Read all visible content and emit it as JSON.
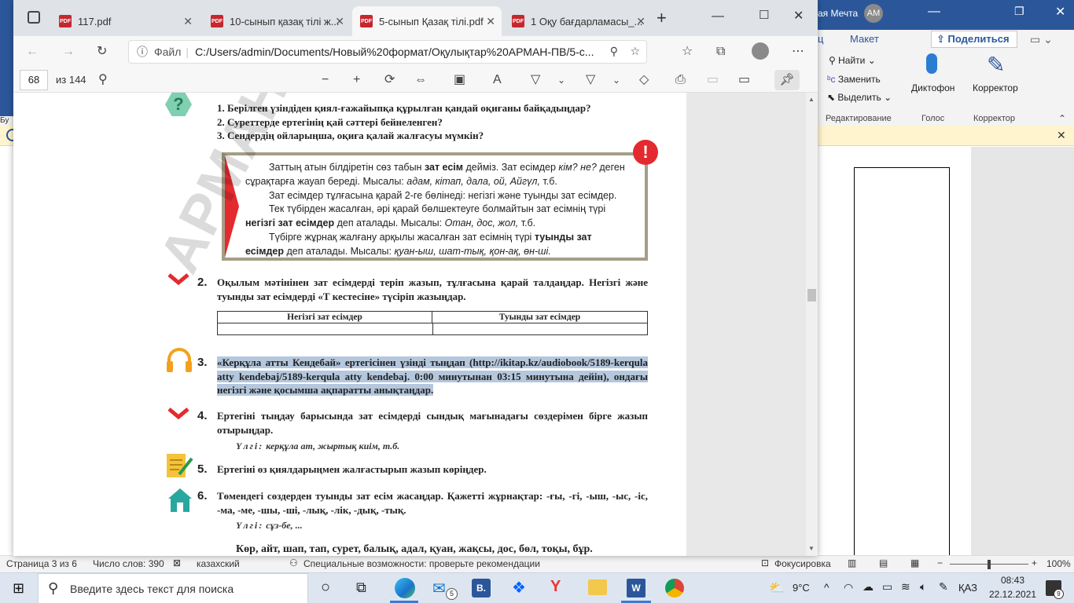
{
  "edge": {
    "tabs": [
      {
        "label": "117.pdf",
        "active": false
      },
      {
        "label": "10-сынып қазақ тілі ж...",
        "active": false
      },
      {
        "label": "5-сынып Қазақ тілі.pdf",
        "active": true
      },
      {
        "label": "1 Оқу бағдарламасы_...",
        "active": false
      }
    ],
    "new_tab": "+",
    "url_prefix": "Файл",
    "url": "C:/Users/admin/Documents/Новый%20формат/Оқулықтар%20АРМАН-ПВ/5-с...",
    "pdf_toolbar": {
      "page_current": "68",
      "page_total": "из 144"
    }
  },
  "pdf": {
    "questions": [
      "1.  Берілген үзіндіден қиял-ғажайыпқа құрылған қандай оқиғаны байқадыңдар?",
      "2.  Суреттерде ертегінің қай сәттері бейнеленген?",
      "3.  Сендердің ойларыңша, оқиға қалай жалғасуы мүмкін?"
    ],
    "rule_box": {
      "p1_a": "Заттың атын білдіретін сөз табын ",
      "p1_b": "зат есім",
      "p1_c": " дейміз. Зат есімдер ",
      "p1_d": "кім? не?",
      "p1_e": " деген сұрақтарға жауап береді. Мысалы: ",
      "p1_f": "адам, кітап, дала, ой, Айгүл,",
      "p1_g": " т.б.",
      "p2": "Зат есімдер тұлғасына қарай 2-ге бөлінеді: негізгі және туынды зат есімдер.",
      "p3_a": "Тек түбірден жасалған, әрі қарай бөлшектеуге болмайтын зат есімнің түрі ",
      "p3_b": "негізгі зат есімдер",
      "p3_c": " деп аталады. Мысалы: ",
      "p3_d": "Отан, дос, жол,",
      "p3_e": " т.б.",
      "p4_a": "Түбірге жұрнақ жалғану арқылы жасалған зат есімнің түрі ",
      "p4_b": "туынды зат есімдер",
      "p4_c": " деп аталады. Мысалы: ",
      "p4_d": "қуан-ыш, шат-тық, қон-ақ, өн-ші."
    },
    "tasks": [
      {
        "num": "2.",
        "text": "Оқылым мәтінінен зат есімдерді теріп жазып, тұлғасына қарай талдаңдар. Негізгі және туынды зат есімдерді «Т кестесіне» түсіріп жазыңдар."
      },
      {
        "num": "3.",
        "text": "«Керқұла атты Кендебай» ертегісінен үзінді тыңдап (http://ikitap.kz/audiobook/5189-kerqula atty kendebaj/5189-kerqula atty kendebaj. 0:00 минутынан 03:15 минутына дейін), ондағы негізгі және қосымша ақпаратты анықтаңдар."
      },
      {
        "num": "4.",
        "text": "Ертегіні тыңдау барысында зат есімдерді сындық мағынадағы сөздерімен бірге жазып отырыңдар."
      },
      {
        "num": "5.",
        "text": "Ертегіні өз қиялдарыңмен жалғастырып жазып көріңдер."
      },
      {
        "num": "6.",
        "text": "Төмендегі сөздерден туынды зат есім жасаңдар. Қажетті жұрнақтар: -ғы, -гі, -ыш, -ыс, -іс, -ма, -ме, -шы, -ші, -лық, -лік, -дық, -тық."
      }
    ],
    "table_headers": [
      "Негізгі зат есімдер",
      "Туынды зат есімдер"
    ],
    "example4_label": "Үлгі:",
    "example4": "керқұла ат, жыртық киім, т.б.",
    "example6_label": "Үлгі:",
    "example6": "сұз-бе, ...",
    "words_line": "Көр, айт, шап, тап, сурет, балық, адал, қуан, жақсы, дос, бөл, тоқы, бұр.",
    "watermark": "АРМАН-ПВ баспасы"
  },
  "word": {
    "title_user": "ая Мечта",
    "avatar": "AM",
    "tab_c": "ц",
    "tab_maket": "Макет",
    "share": "Поделиться",
    "find": "Найти",
    "replace": "Заменить",
    "select": "Выделить",
    "group_edit": "Редактирование",
    "dictophone": "Диктофон",
    "group_voice": "Голос",
    "corrector": "Корректор",
    "group_corrector": "Корректор",
    "left_trunc": "Бу"
  },
  "status": {
    "page": "Страница 3 из 6",
    "words": "Число слов: 390",
    "lang": "казахский",
    "access": "Специальные возможности: проверьте рекомендации",
    "focus": "Фокусировка",
    "zoom": "100%"
  },
  "taskbar": {
    "search_placeholder": "Введите здесь текст для поиска",
    "weather": "9°C",
    "lang": "ҚАЗ",
    "time": "08:43",
    "date": "22.12.2021",
    "notif": "9",
    "mail_badge": "5"
  }
}
